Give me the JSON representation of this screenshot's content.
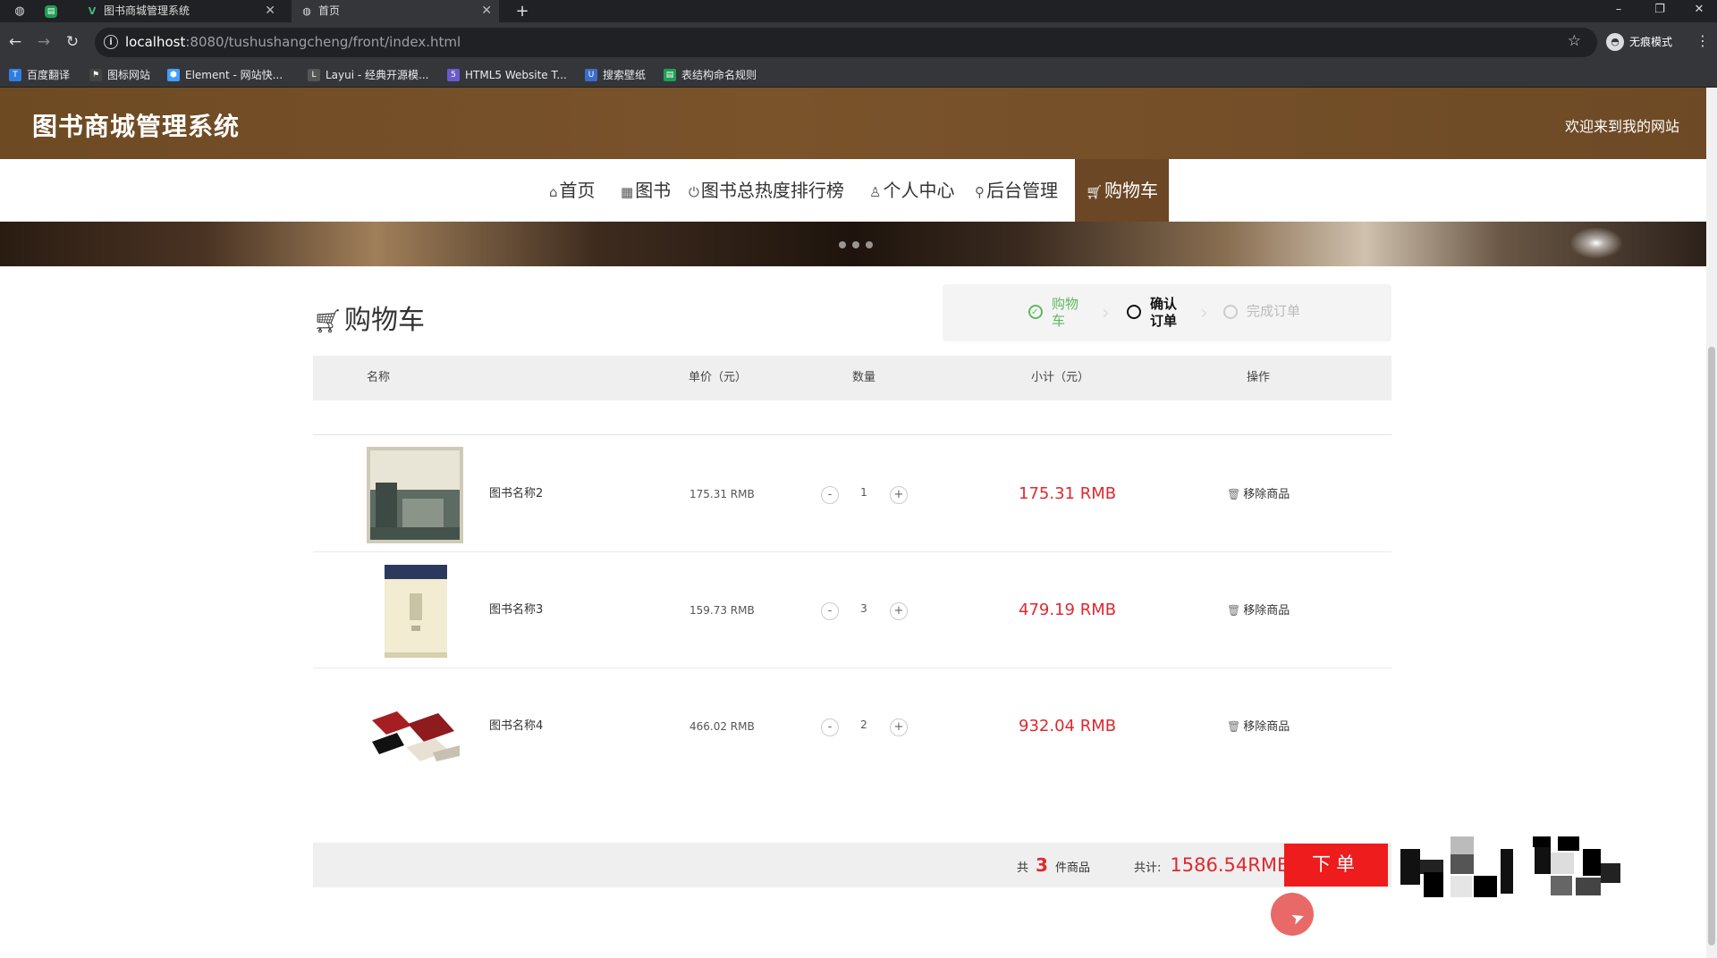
{
  "browser": {
    "tabs": [
      {
        "title": "图书商城管理系统",
        "favicon": "vue-icon"
      },
      {
        "title": "首页",
        "favicon": "globe-icon"
      }
    ],
    "url_host": "localhost",
    "url_path": ":8080/tushushangcheng/front/index.html",
    "profile_label": "无痕模式",
    "bookmarks": [
      "百度翻译",
      "图标网站",
      "Element - 网站快...",
      "Layui - 经典开源模...",
      "HTML5 Website T...",
      "搜索壁纸",
      "表结构命名规则"
    ]
  },
  "site": {
    "title": "图书商城管理系统",
    "welcome": "欢迎来到我的网站",
    "nav": [
      "首页",
      "图书",
      "图书总热度排行榜",
      "个人中心",
      "后台管理",
      "购物车"
    ],
    "active_nav": "购物车"
  },
  "cart": {
    "title": "购物车",
    "steps": [
      {
        "label": "购物车",
        "state": "done"
      },
      {
        "label": "确认订单",
        "state": "current"
      },
      {
        "label": "完成订单",
        "state": "todo"
      }
    ],
    "headers": {
      "name": "名称",
      "unit_price": "单价（元）",
      "quantity": "数量",
      "subtotal": "小计（元）",
      "action": "操作"
    },
    "items": [
      {
        "name": "图书名称2",
        "price": "175.31 RMB",
        "qty": "1",
        "subtotal": "175.31 RMB",
        "remove": "移除商品",
        "minus": "-",
        "plus": "+"
      },
      {
        "name": "图书名称3",
        "price": "159.73 RMB",
        "qty": "3",
        "subtotal": "479.19 RMB",
        "remove": "移除商品",
        "minus": "-",
        "plus": "+"
      },
      {
        "name": "图书名称4",
        "price": "466.02 RMB",
        "qty": "2",
        "subtotal": "932.04 RMB",
        "remove": "移除商品",
        "minus": "-",
        "plus": "+"
      }
    ],
    "summary": {
      "prefix": "共",
      "count": "3",
      "suffix": "件商品",
      "total_label": "共计:",
      "total": "1586.54RMB"
    },
    "order_button": "下单"
  },
  "colors": {
    "header_brown": "#6e4a23",
    "accent_red": "#e0282f",
    "order_red": "#ee1c1c",
    "step_green": "#5fb85f"
  }
}
